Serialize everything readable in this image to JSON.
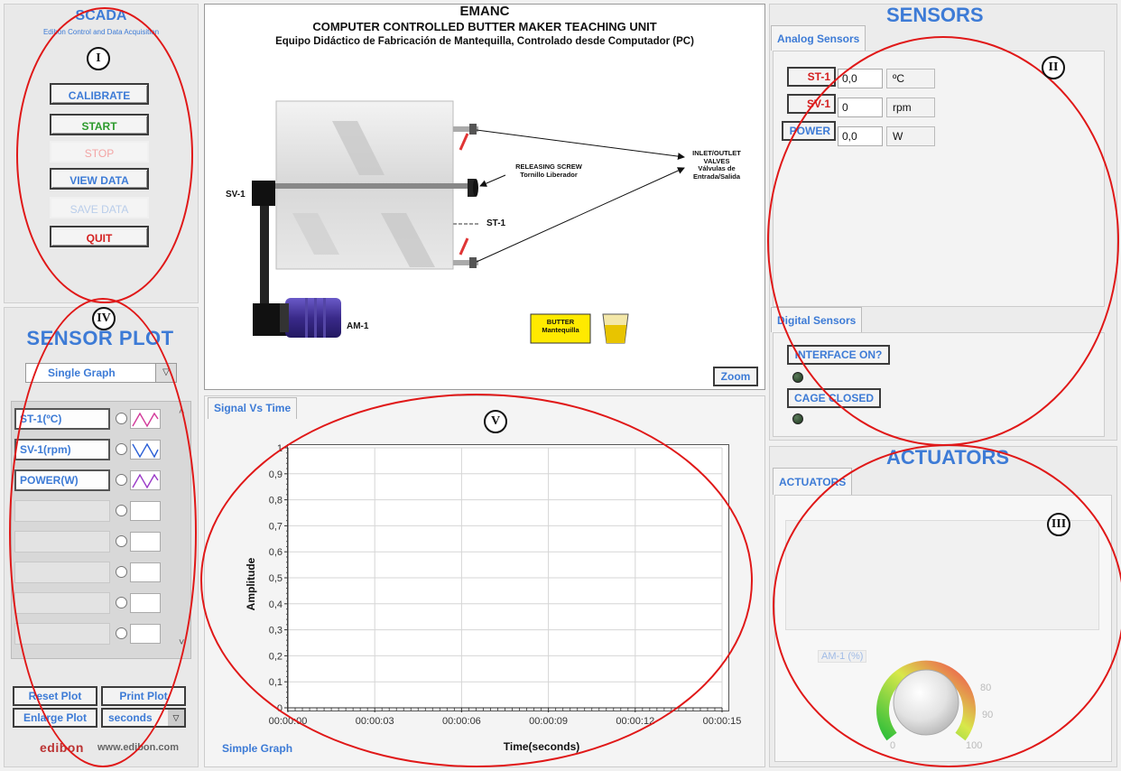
{
  "scada": {
    "title": "SCADA",
    "subtitle": "Edibon Control and Data Acquisition",
    "roman": "I",
    "buttons": {
      "calibrate": "CALIBRATE",
      "start": "START",
      "stop": "STOP",
      "view_data": "VIEW DATA",
      "save_data": "SAVE DATA",
      "quit": "QUIT"
    }
  },
  "diagram": {
    "title": "EMANC",
    "subtitle": "COMPUTER CONTROLLED BUTTER MAKER TEACHING UNIT",
    "subtitle_es": "Equipo Didáctico de Fabricación de Mantequilla, Controlado desde Computador (PC)",
    "labels": {
      "sv1": "SV-1",
      "am1": "AM-1",
      "st1": "ST-1",
      "screw": "RELEASING SCREW",
      "screw_es": "Tornillo Liberador",
      "valves1": "INLET/OUTLET",
      "valves2": "VALVES",
      "valves3": "Válvulas de",
      "valves4": "Entrada/Salida",
      "butter": "BUTTER",
      "butter_es": "Mantequilla"
    },
    "zoom": "Zoom"
  },
  "sensors": {
    "title": "SENSORS",
    "roman": "II",
    "analog_tab": "Analog Sensors",
    "analog": [
      {
        "label": "ST-1",
        "value": "0,0",
        "unit": "ºC"
      },
      {
        "label": "SV-1",
        "value": "0",
        "unit": "rpm"
      },
      {
        "label": "POWER",
        "value": "0,0",
        "unit": "W"
      }
    ],
    "digital_tab": "Digital Sensors",
    "digital": [
      {
        "label": "INTERFACE ON?"
      },
      {
        "label": "CAGE CLOSED"
      }
    ]
  },
  "actuators": {
    "title": "ACTUATORS",
    "roman": "III",
    "tab": "ACTUATORS",
    "knob_label": "AM-1 (%)",
    "knob_value": 0,
    "knob_ticks": [
      "0",
      "80",
      "90",
      "100"
    ]
  },
  "sensor_plot": {
    "title": "SENSOR PLOT",
    "roman": "IV",
    "mode": "Single Graph",
    "legend": [
      {
        "name": "ST-1(ºC)",
        "color": "#d23a9a"
      },
      {
        "name": "SV-1(rpm)",
        "color": "#2a5fd6"
      },
      {
        "name": "POWER(W)",
        "color": "#9a3ac8"
      }
    ],
    "reset": "Reset Plot",
    "print": "Print Plot",
    "enlarge": "Enlarge Plot",
    "units": "seconds",
    "brand": "edibon",
    "url": "www.edibon.com"
  },
  "graph": {
    "roman": "V",
    "tab": "Signal Vs Time",
    "footer": "Simple Graph"
  },
  "chart_data": {
    "type": "line",
    "title": "",
    "xlabel": "Time(seconds)",
    "ylabel": "Amplitude",
    "xlim": [
      0,
      15
    ],
    "ylim": [
      0,
      1
    ],
    "x_ticks": [
      "00:00:00",
      "00:00:03",
      "00:00:06",
      "00:00:09",
      "00:00:12",
      "00:00:15"
    ],
    "y_ticks": [
      "0",
      "0,1",
      "0,2",
      "0,3",
      "0,4",
      "0,5",
      "0,6",
      "0,7",
      "0,8",
      "0,9",
      "1"
    ],
    "grid": true,
    "series": []
  }
}
